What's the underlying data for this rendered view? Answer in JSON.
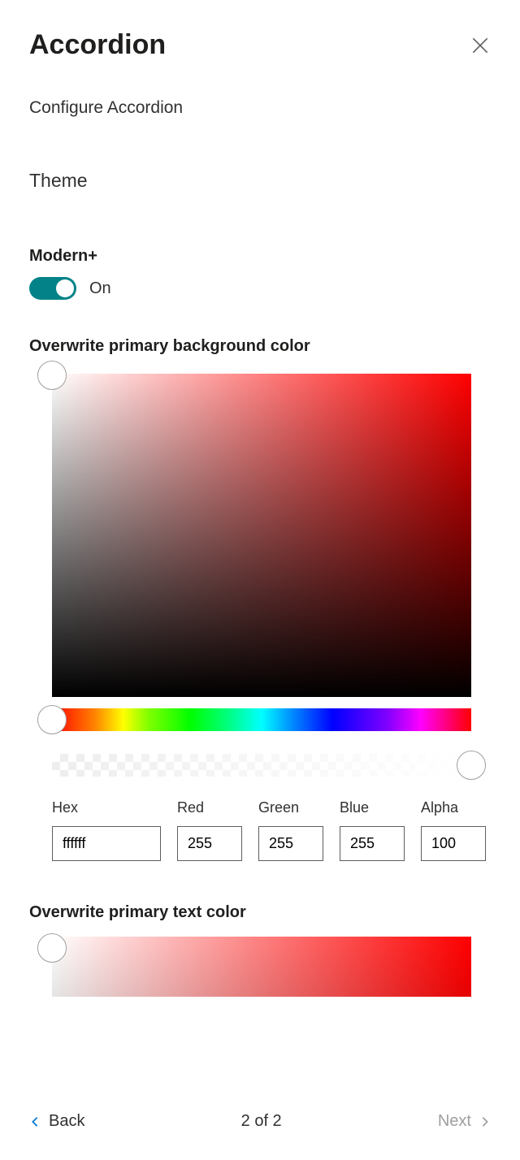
{
  "header": {
    "title": "Accordion",
    "subtitle": "Configure Accordion"
  },
  "theme": {
    "section_label": "Theme",
    "modern_label": "Modern+",
    "toggle_state": "On",
    "toggle_on": true
  },
  "bg_color": {
    "label": "Overwrite primary background color",
    "hex_label": "Hex",
    "red_label": "Red",
    "green_label": "Green",
    "blue_label": "Blue",
    "alpha_label": "Alpha",
    "hex": "ffffff",
    "red": "255",
    "green": "255",
    "blue": "255",
    "alpha": "100"
  },
  "text_color": {
    "label": "Overwrite primary text color"
  },
  "footer": {
    "back_label": "Back",
    "next_label": "Next",
    "pager": "2 of 2"
  },
  "colors": {
    "accent": "#038387",
    "link": "#0078d4"
  }
}
